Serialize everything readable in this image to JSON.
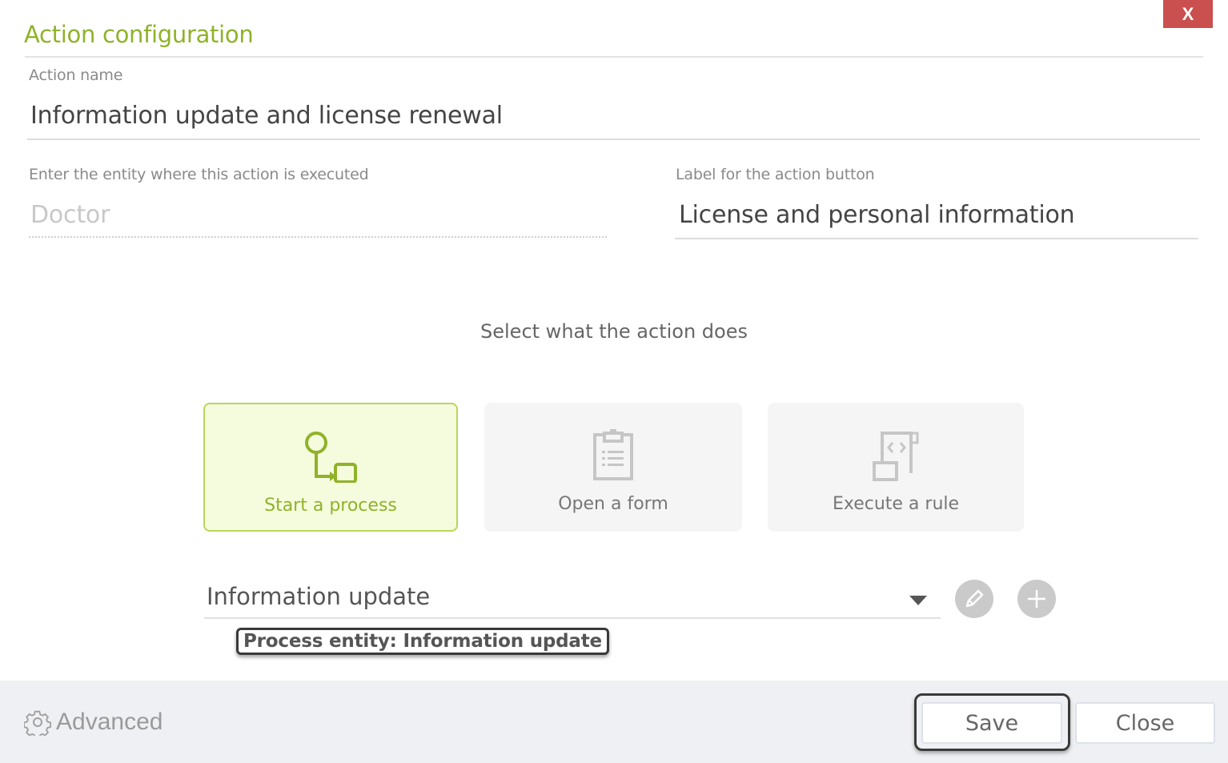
{
  "dialog": {
    "title": "Action configuration",
    "close_label": "X"
  },
  "fields": {
    "action_name": {
      "label": "Action name",
      "value": "Information update and license renewal"
    },
    "entity": {
      "label": "Enter the entity where this action is executed",
      "value": "Doctor"
    },
    "button_label": {
      "label": "Label for the action button",
      "value": "License and personal information"
    }
  },
  "action_type": {
    "heading": "Select what the action does",
    "options": [
      {
        "label": "Start a process",
        "icon": "process-icon",
        "selected": true
      },
      {
        "label": "Open a form",
        "icon": "clipboard-form-icon",
        "selected": false
      },
      {
        "label": "Execute a rule",
        "icon": "rule-script-icon",
        "selected": false
      }
    ]
  },
  "process_select": {
    "value": "Information update",
    "tooltip": "Process entity: Information update"
  },
  "footer": {
    "advanced_label": "Advanced",
    "save_label": "Save",
    "close_label": "Close"
  },
  "colors": {
    "accent": "#8fb22a",
    "close_button": "#c9504f",
    "selected_bg": "#f5fcdd"
  }
}
